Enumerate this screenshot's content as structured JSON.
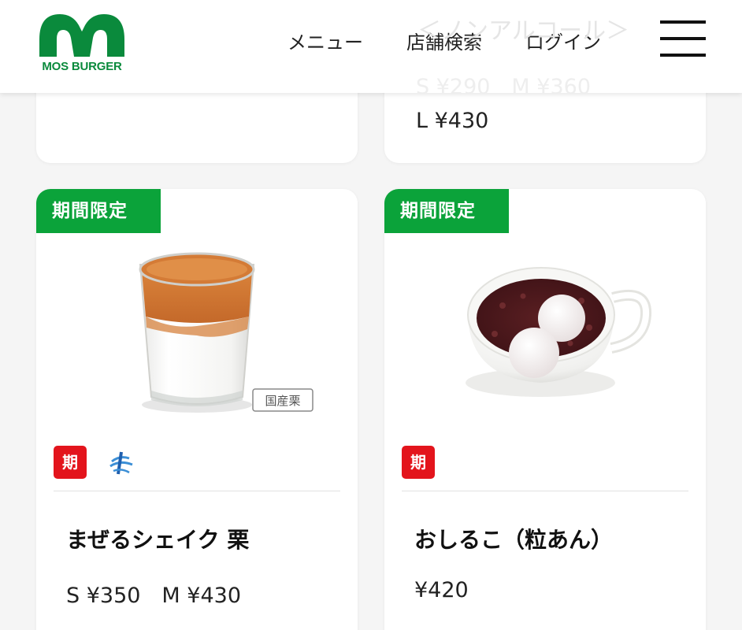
{
  "header": {
    "logo_text": "MOS BURGER",
    "nav": {
      "menu": "メニュー",
      "store_search": "店舗検索",
      "login": "ログイン"
    },
    "brand_color": "#0a8a3c"
  },
  "previous_cards": {
    "right": {
      "name_partial": "＜ノンアルコール＞",
      "price_partial": "S ¥290　M ¥360",
      "price_l": "L ¥430"
    }
  },
  "products": [
    {
      "badge": "期間限定",
      "name": "まぜるシェイク 栗",
      "price": "S ¥350　M ¥430",
      "image_label": "国産栗",
      "icons": [
        "limited-period-icon",
        "mazeru-shake-icon"
      ],
      "limited_icon_text": "期"
    },
    {
      "badge": "期間限定",
      "name": "おしるこ（粒あん）",
      "price": "¥420",
      "icons": [
        "limited-period-icon"
      ],
      "limited_icon_text": "期"
    }
  ],
  "colors": {
    "badge_green": "#0ba33a",
    "limited_red": "#e3141c"
  }
}
